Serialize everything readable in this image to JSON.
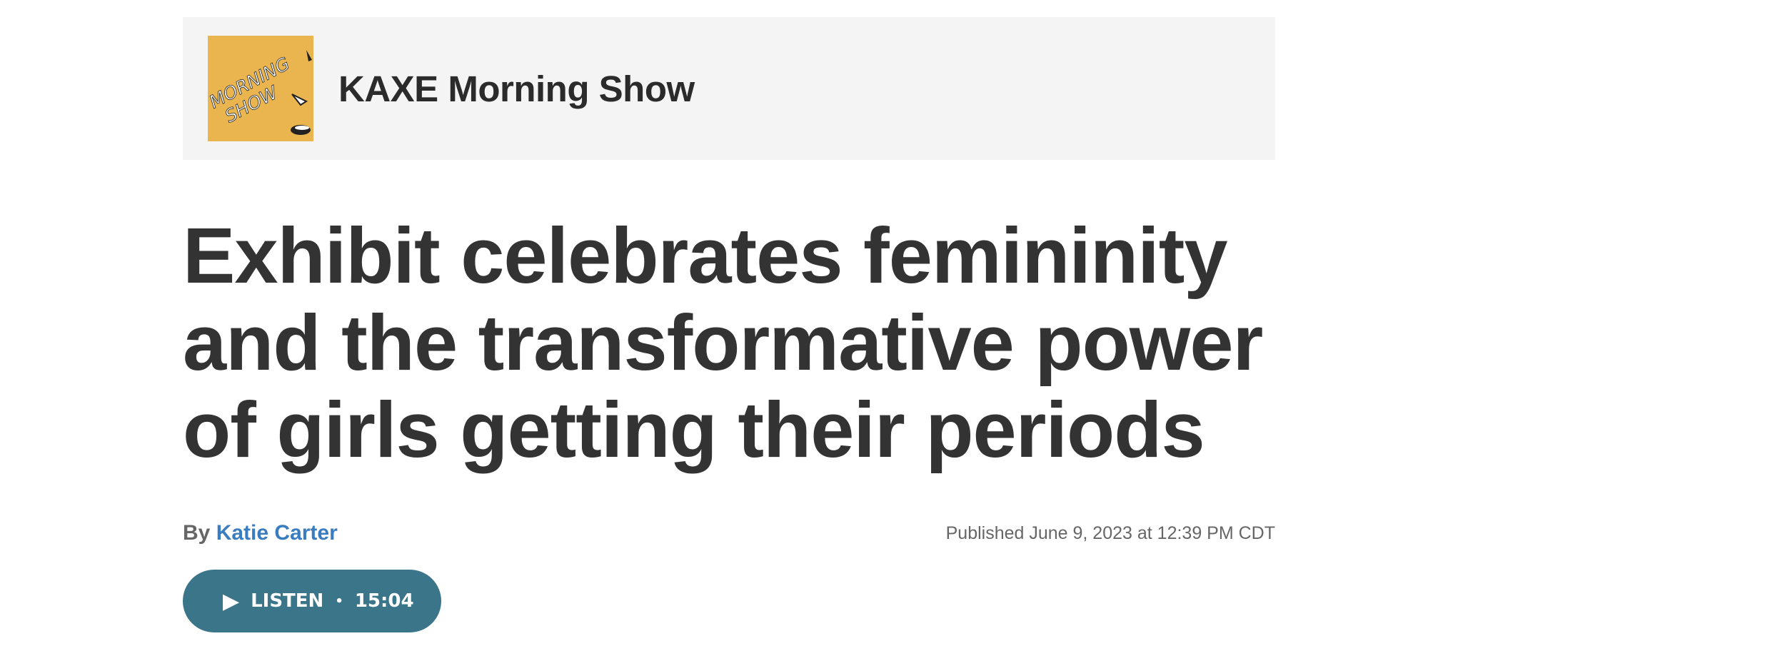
{
  "program": {
    "logo_text_line1": "MORNING",
    "logo_text_line2": "SHOW",
    "name": "KAXE Morning Show"
  },
  "article": {
    "headline": "Exhibit celebrates femininity and the transformative power of girls getting their periods",
    "byline_prefix": "By",
    "author": "Katie Carter",
    "published": "Published June 9, 2023 at 12:39 PM CDT"
  },
  "audio": {
    "play_symbol": "▶",
    "listen_label": "LISTEN",
    "separator": "•",
    "duration": "15:04"
  },
  "colors": {
    "logo_bg": "#eab54f",
    "author_link": "#3a7cc0",
    "listen_button": "#3b7589"
  }
}
